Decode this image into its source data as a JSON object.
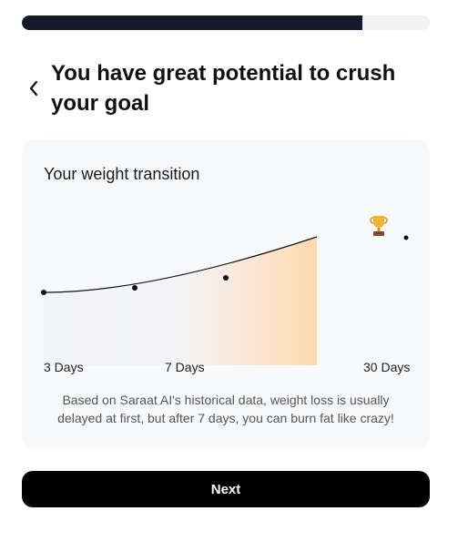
{
  "progress": {
    "fraction": 0.835
  },
  "header": {
    "back_icon": "chevron-left-icon",
    "title": "You have great potential to crush your goal"
  },
  "card": {
    "title": "Your weight transition",
    "caption": "Based on Saraat AI's historical data, weight loss is usually delayed at first, but after 7 days, you can burn fat like crazy!",
    "trophy_icon": "trophy-icon"
  },
  "chart_data": {
    "type": "area",
    "x_tick_labels": [
      "3 Days",
      "7 Days",
      "30 Days"
    ],
    "gradient_colors": [
      "#f2f3f6",
      "#ffd9b0"
    ],
    "line_color": "#111111"
  },
  "footer": {
    "next_label": "Next"
  },
  "colors": {
    "progress_fill": "#141a2b",
    "progress_track": "#f2f2f2",
    "button_bg": "#000000",
    "card_bg": "#f8f9fb"
  }
}
